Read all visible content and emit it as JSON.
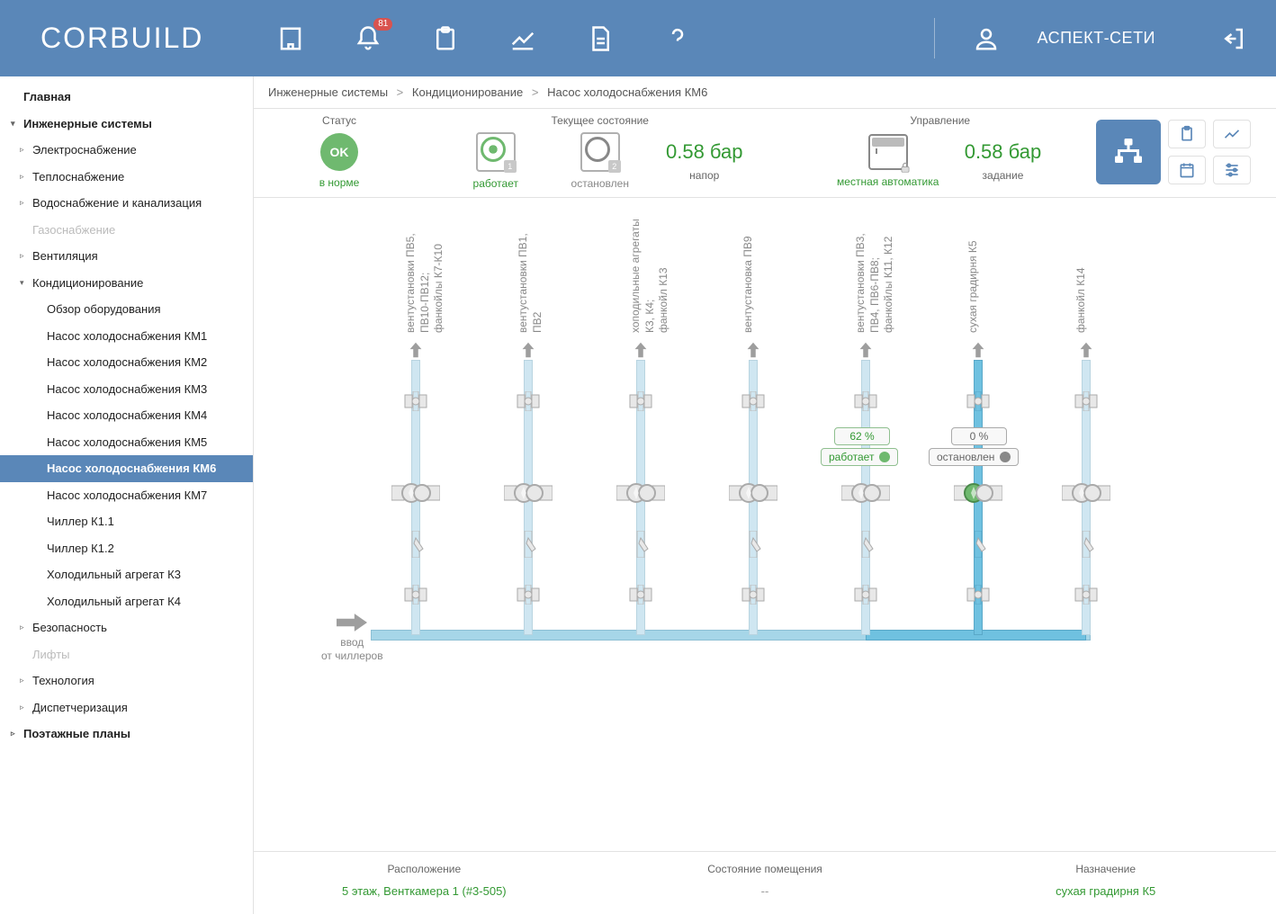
{
  "header": {
    "logo": "CORBUILD",
    "notif_count": "81",
    "user_label": "АСПЕКТ-СЕТИ"
  },
  "sidebar": {
    "items": [
      {
        "label": "Главная",
        "lvl": 1,
        "bold": true,
        "caret": ""
      },
      {
        "label": "Инженерные системы",
        "lvl": 1,
        "bold": true,
        "caret": "▾"
      },
      {
        "label": "Электроснабжение",
        "lvl": 2,
        "caret": "▹"
      },
      {
        "label": "Теплоснабжение",
        "lvl": 2,
        "caret": "▹"
      },
      {
        "label": "Водоснабжение и канализация",
        "lvl": 2,
        "caret": "▹"
      },
      {
        "label": "Газоснабжение",
        "lvl": 2,
        "disabled": true,
        "caret": ""
      },
      {
        "label": "Вентиляция",
        "lvl": 2,
        "caret": "▹"
      },
      {
        "label": "Кондиционирование",
        "lvl": 2,
        "caret": "▾"
      },
      {
        "label": "Обзор оборудования",
        "lvl": 3,
        "caret": ""
      },
      {
        "label": "Насос холодоснабжения КМ1",
        "lvl": 3,
        "caret": ""
      },
      {
        "label": "Насос холодоснабжения КМ2",
        "lvl": 3,
        "caret": ""
      },
      {
        "label": "Насос холодоснабжения КМ3",
        "lvl": 3,
        "caret": ""
      },
      {
        "label": "Насос холодоснабжения КМ4",
        "lvl": 3,
        "caret": ""
      },
      {
        "label": "Насос холодоснабжения КМ5",
        "lvl": 3,
        "caret": ""
      },
      {
        "label": "Насос холодоснабжения КМ6",
        "lvl": 3,
        "active": true,
        "caret": ""
      },
      {
        "label": "Насос холодоснабжения КМ7",
        "lvl": 3,
        "caret": ""
      },
      {
        "label": "Чиллер К1.1",
        "lvl": 3,
        "caret": ""
      },
      {
        "label": "Чиллер К1.2",
        "lvl": 3,
        "caret": ""
      },
      {
        "label": "Холодильный агрегат К3",
        "lvl": 3,
        "caret": ""
      },
      {
        "label": "Холодильный агрегат К4",
        "lvl": 3,
        "caret": ""
      },
      {
        "label": "Безопасность",
        "lvl": 2,
        "caret": "▹"
      },
      {
        "label": "Лифты",
        "lvl": 2,
        "disabled": true,
        "caret": ""
      },
      {
        "label": "Технология",
        "lvl": 2,
        "caret": "▹"
      },
      {
        "label": "Диспетчеризация",
        "lvl": 2,
        "caret": "▹"
      },
      {
        "label": "Поэтажные планы",
        "lvl": 1,
        "bold": true,
        "caret": "▹"
      }
    ]
  },
  "breadcrumb": {
    "p0": "Инженерные системы",
    "p1": "Кондиционирование",
    "p2": "Насос холодоснабжения КМ6"
  },
  "summary": {
    "status_title": "Статус",
    "status_ok": "OK",
    "status_text": "в норме",
    "state_title": "Текущее состояние",
    "pump1_tag": "1",
    "pump1_text": "работает",
    "pump2_tag": "2",
    "pump2_text": "остановлен",
    "pressure_val": "0.58 бар",
    "pressure_lbl": "напор",
    "ctrl_title": "Управление",
    "ctrl_mode": "местная автоматика",
    "setpoint_val": "0.58 бар",
    "setpoint_lbl": "задание"
  },
  "diagram": {
    "branch_labels": [
      "вентустановки ПВ5,\nПВ10-ПВ12;\nфанкойлы К7-К10",
      "вентустановки ПВ1,\nПВ2",
      "хоподильные агрегаты\nК3, К4;\nфанкойл К13",
      "вентустановка ПВ9",
      "вентустановки ПВ3,\nПВ4, ПВ6-ПВ8;\nфанкойлы К11, К12",
      "сухая градирня К5",
      "фанкойл К14"
    ],
    "chip_pct_1": "62 %",
    "chip_run": "работает",
    "chip_pct_2": "0 %",
    "chip_stop": "остановлен",
    "inlet_l1": "ввод",
    "inlet_l2": "от чиллеров"
  },
  "footer": {
    "loc_title": "Расположение",
    "loc_val": "5 этаж, Венткамера 1 (#3-505)",
    "room_title": "Состояние помещения",
    "room_val": "--",
    "purpose_title": "Назначение",
    "purpose_val": "сухая градирня К5"
  }
}
